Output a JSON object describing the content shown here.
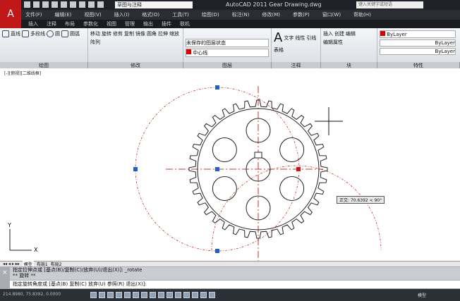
{
  "title_bar": {
    "app_title": "AutoCAD 2011    Gear Drawing.dwg",
    "workspace": "草图与注释",
    "search_placeholder": "键入关键字或短语"
  },
  "menu": [
    "文件(F)",
    "编辑(E)",
    "视图(V)",
    "插入(I)",
    "格式(O)",
    "工具(T)",
    "绘图(D)",
    "标注(N)",
    "修改(M)",
    "参数(P)",
    "窗口(W)",
    "帮助(H)"
  ],
  "ribbon_tabs": [
    "常用",
    "插入",
    "注释",
    "布局",
    "参数化",
    "视图",
    "管理",
    "输出",
    "插件",
    "联机"
  ],
  "panels": {
    "draw": {
      "title": "绘图",
      "items": [
        "直线",
        "多段线",
        "圆",
        "圆弧"
      ]
    },
    "modify": {
      "title": "修改",
      "items": [
        "移动",
        "旋转",
        "修剪",
        "复制",
        "镜像",
        "圆角",
        "拉伸",
        "缩放",
        "阵列"
      ]
    },
    "layers": {
      "title": "图层",
      "state": "未保存的图层状态",
      "current": "中心线"
    },
    "annotation": {
      "title": "注释",
      "items": [
        "文字",
        "线性",
        "引线",
        "表格"
      ]
    },
    "block": {
      "title": "块",
      "items": [
        "插入",
        "创建",
        "编辑",
        "编辑属性"
      ]
    },
    "properties": {
      "title": "特性",
      "color": "ByLayer",
      "linetype": "ByLayer",
      "lineweight": "ByLayer"
    }
  },
  "canvas": {
    "viewport_label": "[-][俯视][二维线框]",
    "tooltip": "正交: 70.6392 < 90°",
    "ucs_x": "X",
    "ucs_y": "Y",
    "accent": "#c0392b"
  },
  "layout_tabs": [
    "模型",
    "布局1",
    "布局2"
  ],
  "command": {
    "history1": "指定拉伸点或 [基点(B)/复制(C)/放弃(U)/退出(X)]: _rotate",
    "history2": "** 旋转 **",
    "prompt": "指定旋转角度或 [基点(B) 复制(C) 放弃(U) 参照(R) 退出(X)]:"
  },
  "status": {
    "coords": "214.8980, 75.8392, 0.0000",
    "model": "模型"
  }
}
